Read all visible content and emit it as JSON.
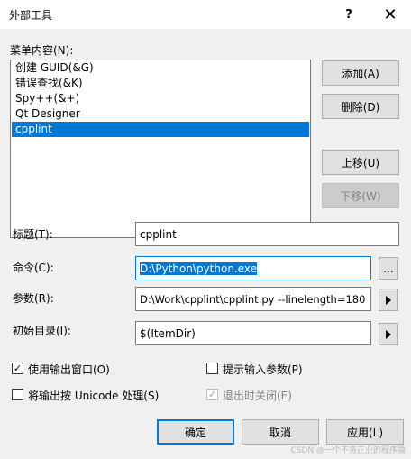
{
  "window": {
    "title": "外部工具",
    "help_label": "?",
    "close_label": "✕"
  },
  "menu_contents": {
    "label": "菜单内容(N):",
    "items": [
      {
        "label": "创建 GUID(&G)"
      },
      {
        "label": "错误查找(&K)"
      },
      {
        "label": "Spy++(&+)"
      },
      {
        "label": "Qt Designer"
      },
      {
        "label": "cpplint",
        "selected": true
      }
    ]
  },
  "side_buttons": {
    "add": "添加(A)",
    "delete": "删除(D)",
    "move_up": "上移(U)",
    "move_down": "下移(W)"
  },
  "fields": {
    "title": {
      "label": "标题(T):",
      "value": "cpplint"
    },
    "command": {
      "label": "命令(C):",
      "value": "D:\\Python\\python.exe",
      "browse_label": "..."
    },
    "arguments": {
      "label": "参数(R):",
      "value": "D:\\Work\\cpplint\\cpplint.py --linelength=180"
    },
    "initial_dir": {
      "label": "初始目录(I):",
      "value": "$(ItemDir)"
    }
  },
  "checkboxes": {
    "use_output_window": {
      "label": "使用输出窗口(O)",
      "checked": true
    },
    "prompt_args": {
      "label": "提示输入参数(P)",
      "checked": false
    },
    "unicode_output": {
      "label": "将输出按 Unicode 处理(S)",
      "checked": false
    },
    "close_on_exit": {
      "label": "退出时关闭(E)",
      "checked": true,
      "disabled": true
    }
  },
  "footer": {
    "ok": "确定",
    "cancel": "取消",
    "apply": "应用(L)"
  },
  "watermark": "CSDN @一个不务正业的程序猿",
  "colors": {
    "selection": "#0078d7",
    "dialog_bg": "#f0f0f0"
  }
}
